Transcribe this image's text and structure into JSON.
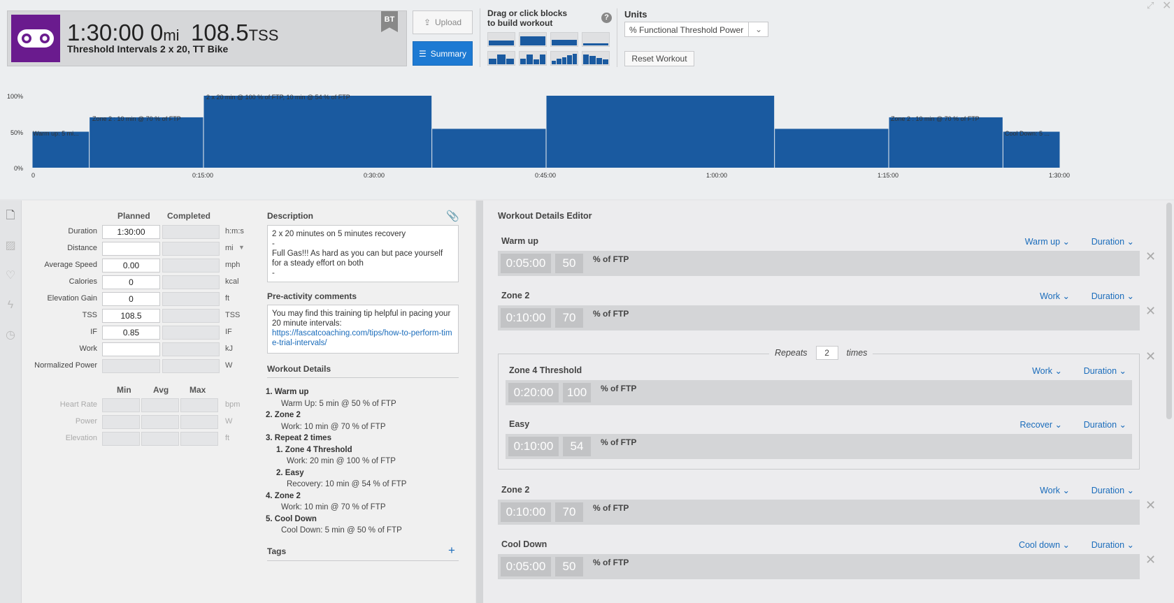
{
  "summary": {
    "duration": "1:30:00",
    "distance": "0",
    "distance_unit": "mi",
    "tss": "108.5",
    "tss_unit": "TSS",
    "title": "Threshold Intervals 2 x 20, TT Bike",
    "badge": "BT",
    "sport_icon": "bike-icon",
    "accent": "#6a1b8e"
  },
  "toolbar": {
    "upload": "Upload",
    "summary": "Summary"
  },
  "builder": {
    "drag_line1": "Drag or click blocks",
    "drag_line2": "to build workout",
    "help": "?"
  },
  "units": {
    "label": "Units",
    "selected": "% Functional Threshold Power",
    "reset": "Reset Workout"
  },
  "chart_data": {
    "type": "bar",
    "ylim": [
      0,
      100
    ],
    "yticks": [
      "100%",
      "50%",
      "0%"
    ],
    "xticks": [
      "0",
      "0:15:00",
      "0:30:00",
      "0:45:00",
      "1:00:00",
      "1:15:00",
      "1:30:00"
    ],
    "xlim_minutes": [
      0,
      90
    ],
    "segments": [
      {
        "start": 0,
        "end": 5,
        "value": 50
      },
      {
        "start": 5,
        "end": 15,
        "value": 70
      },
      {
        "start": 15,
        "end": 35,
        "value": 100
      },
      {
        "start": 35,
        "end": 45,
        "value": 54
      },
      {
        "start": 45,
        "end": 65,
        "value": 100
      },
      {
        "start": 65,
        "end": 75,
        "value": 54
      },
      {
        "start": 75,
        "end": 85,
        "value": 70
      },
      {
        "start": 85,
        "end": 90,
        "value": 50
      }
    ],
    "annotations": [
      "Warm up: 5 mi...",
      "Zone 2 : 10 min @ 70 % of FTP",
      "2 x 20 min @ 100 % of FTP, 10 min @ 54 % of FTP",
      "Zone 2 : 10 min @ 70 % of FTP",
      "Cool Down: 5 ..."
    ],
    "bar_color": "#1a5aa0"
  },
  "metrics": {
    "planned_header": "Planned",
    "completed_header": "Completed",
    "rows": [
      {
        "label": "Duration",
        "planned": "1:30:00",
        "unit": "h:m:s"
      },
      {
        "label": "Distance",
        "planned": "",
        "unit": "mi"
      },
      {
        "label": "Average Speed",
        "planned": "0.00",
        "unit": "mph"
      },
      {
        "label": "Calories",
        "planned": "0",
        "unit": "kcal"
      },
      {
        "label": "Elevation Gain",
        "planned": "0",
        "unit": "ft"
      },
      {
        "label": "TSS",
        "planned": "108.5",
        "unit": "TSS"
      },
      {
        "label": "IF",
        "planned": "0.85",
        "unit": "IF"
      },
      {
        "label": "Work",
        "planned": "",
        "unit": "kJ"
      },
      {
        "label": "Normalized Power",
        "planned": "",
        "unit": "W"
      }
    ],
    "mam_headers": [
      "Min",
      "Avg",
      "Max"
    ],
    "mam_rows": [
      {
        "label": "Heart Rate",
        "unit": "bpm"
      },
      {
        "label": "Power",
        "unit": "W"
      },
      {
        "label": "Elevation",
        "unit": "ft"
      }
    ]
  },
  "description": {
    "header": "Description",
    "line1": "2 x 20 minutes on 5 minutes recovery",
    "dash1": "-",
    "line2": "Full Gas!!! As hard as you can but pace yourself for a steady effort on both",
    "dash2": "-"
  },
  "pre_activity": {
    "header": "Pre-activity comments",
    "text": "You may find this training tip helpful in pacing your 20 minute intervals:",
    "link": "https://fascatcoaching.com/tips/how-to-perform-time-trial-intervals/"
  },
  "workout_details": {
    "header": "Workout Details",
    "items": [
      {
        "n": "1.",
        "title": "Warm up",
        "desc": "Warm Up: 5 min @ 50 % of FTP"
      },
      {
        "n": "2.",
        "title": "Zone 2",
        "desc": "Work: 10 min @ 70 % of FTP"
      },
      {
        "n": "3.",
        "title": "Repeat 2 times",
        "desc": ""
      },
      {
        "n": "1.",
        "title": "Zone 4 Threshold",
        "desc": "Work: 20 min @ 100 % of FTP"
      },
      {
        "n": "2.",
        "title": "Easy",
        "desc": "Recovery: 10 min @ 54 % of FTP"
      },
      {
        "n": "4.",
        "title": "Zone 2",
        "desc": "Work: 10 min @ 70 % of FTP"
      },
      {
        "n": "5.",
        "title": "Cool Down",
        "desc": "Cool Down: 5 min @ 50 % of FTP"
      }
    ]
  },
  "tags": {
    "header": "Tags",
    "add": "+"
  },
  "editor": {
    "title": "Workout Details Editor",
    "pct_label": "% of FTP",
    "duration_dd": "Duration",
    "repeats_label": "Repeats",
    "repeats_value": "2",
    "times_label": "times",
    "steps": [
      {
        "name": "Warm up",
        "type": "Warm up",
        "time": "0:05:00",
        "pct": "50"
      },
      {
        "name": "Zone 2",
        "type": "Work",
        "time": "0:10:00",
        "pct": "70"
      },
      {
        "name": "Zone 4 Threshold",
        "type": "Work",
        "time": "0:20:00",
        "pct": "100"
      },
      {
        "name": "Easy",
        "type": "Recover",
        "time": "0:10:00",
        "pct": "54"
      },
      {
        "name": "Zone 2",
        "type": "Work",
        "time": "0:10:00",
        "pct": "70"
      },
      {
        "name": "Cool Down",
        "type": "Cool down",
        "time": "0:05:00",
        "pct": "50"
      }
    ]
  }
}
